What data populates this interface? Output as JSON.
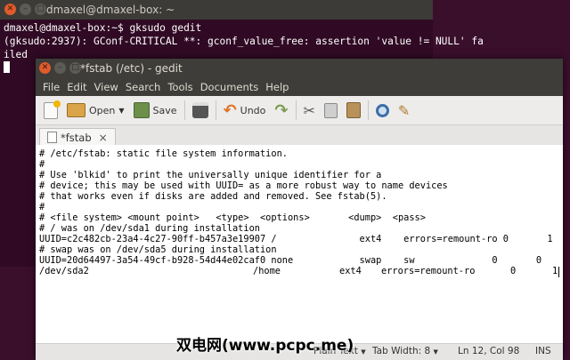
{
  "terminal": {
    "title": "dmaxel@dmaxel-box: ~",
    "lines": [
      "dmaxel@dmaxel-box:~$ gksudo gedit",
      "",
      "(gksudo:2937): GConf-CRITICAL **: gconf_value_free: assertion 'value != NULL' fa",
      "iled"
    ]
  },
  "gedit": {
    "title": "*fstab (/etc) - gedit",
    "menu": [
      "File",
      "Edit",
      "View",
      "Search",
      "Tools",
      "Documents",
      "Help"
    ],
    "toolbar": {
      "open": "Open",
      "save": "Save",
      "undo": "Undo"
    },
    "tab": {
      "label": "*fstab",
      "close": "×"
    },
    "lines": [
      "# /etc/fstab: static file system information.",
      "#",
      "# Use 'blkid' to print the universally unique identifier for a",
      "# device; this may be used with UUID= as a more robust way to name devices",
      "# that works even if disks are added and removed. See fstab(5).",
      "#",
      "# <file system> <mount point>   <type>  <options>       <dump>  <pass>",
      "# / was on /dev/sda1 during installation",
      "UUID=c2c482cb-23a4-4c27-90ff-b457a3e19907 /               ext4    errors=remount-ro 0       1",
      "# swap was on /dev/sda5 during installation",
      "UUID=20d64497-3a54-49cf-b928-54d44e02caf0 none            swap    sw              0       0"
    ],
    "last_line": {
      "device": "/dev/sda2",
      "mount": "/home",
      "type": "ext4",
      "options": "errors=remount-ro",
      "dump": "0",
      "pass": "1"
    },
    "status": {
      "lang": "Plain Text",
      "tab_width": "Tab Width: 8",
      "position": "Ln 12, Col 98",
      "mode": "INS"
    }
  },
  "watermark": "双电网(www.pcpc.me)"
}
